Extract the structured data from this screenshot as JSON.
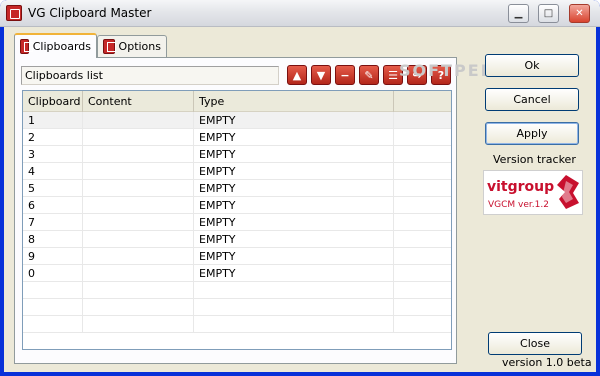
{
  "window": {
    "title": "VG Clipboard Master"
  },
  "tabs": [
    {
      "label": "Clipboards"
    },
    {
      "label": "Options"
    }
  ],
  "list": {
    "caption": "Clipboards list"
  },
  "toolbar": {
    "icons": [
      "move-up-icon",
      "move-down-icon",
      "remove-icon",
      "edit-icon",
      "notes-icon",
      "export-icon",
      "help-icon"
    ]
  },
  "table": {
    "headers": [
      "Clipboard",
      "Content",
      "Type"
    ],
    "rows": [
      {
        "clipboard": "1",
        "content": "",
        "type": "EMPTY"
      },
      {
        "clipboard": "2",
        "content": "",
        "type": "EMPTY"
      },
      {
        "clipboard": "3",
        "content": "",
        "type": "EMPTY"
      },
      {
        "clipboard": "4",
        "content": "",
        "type": "EMPTY"
      },
      {
        "clipboard": "5",
        "content": "",
        "type": "EMPTY"
      },
      {
        "clipboard": "6",
        "content": "",
        "type": "EMPTY"
      },
      {
        "clipboard": "7",
        "content": "",
        "type": "EMPTY"
      },
      {
        "clipboard": "8",
        "content": "",
        "type": "EMPTY"
      },
      {
        "clipboard": "9",
        "content": "",
        "type": "EMPTY"
      },
      {
        "clipboard": "0",
        "content": "",
        "type": "EMPTY"
      }
    ]
  },
  "buttons": {
    "ok": "Ok",
    "cancel": "Cancel",
    "apply": "Apply",
    "close": "Close"
  },
  "version_tracker": {
    "label": "Version tracker",
    "logo_text": "vitgroup",
    "logo_version": "VGCM ver.1.2"
  },
  "footer": {
    "version": "version 1.0 beta"
  },
  "watermark": "SOFTPEDIA",
  "colors": {
    "accent": "#c8102e",
    "tab_highlight": "#f1b338"
  }
}
